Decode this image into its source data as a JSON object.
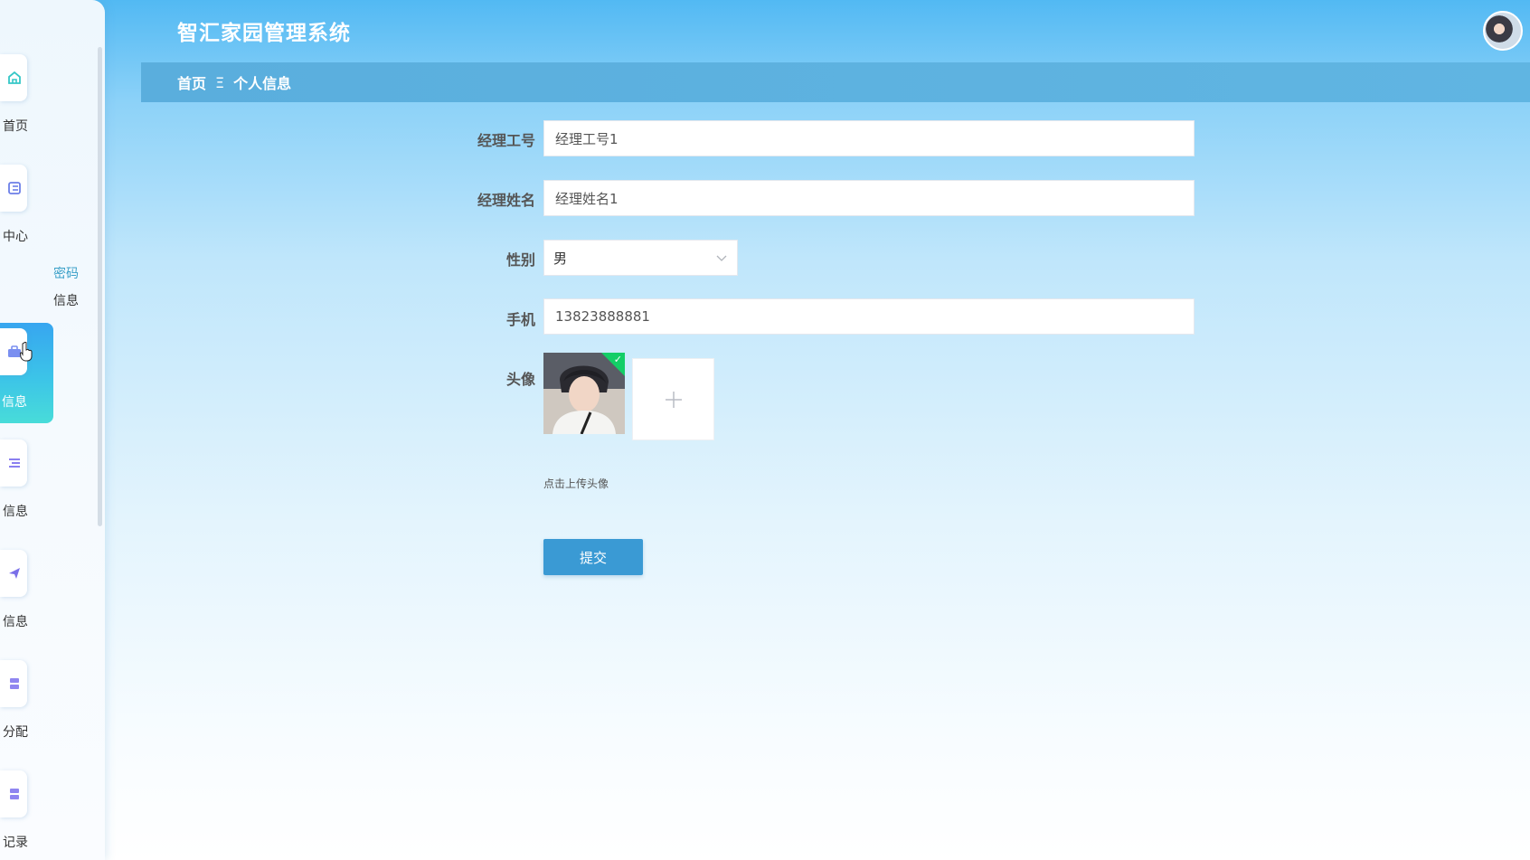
{
  "app": {
    "title": "智汇家园管理系统"
  },
  "breadcrumb": {
    "home": "首页",
    "separator": "Ξ",
    "current": "个人信息"
  },
  "sidebar": {
    "items": [
      {
        "label": "首页",
        "icon": "home-icon"
      },
      {
        "label": "中心",
        "icon": "card-icon"
      },
      {
        "sub_link": "密码",
        "sub_label": "信息"
      },
      {
        "label": "信息",
        "icon": "briefcase-icon",
        "active": true
      },
      {
        "label": "信息",
        "icon": "list-icon"
      },
      {
        "label": "信息",
        "icon": "send-icon"
      },
      {
        "label": "分配",
        "icon": "grid-icon"
      },
      {
        "label": "记录",
        "icon": "grid-icon"
      }
    ]
  },
  "form": {
    "manager_id": {
      "label": "经理工号",
      "value": "经理工号1"
    },
    "manager_name": {
      "label": "经理姓名",
      "value": "经理姓名1"
    },
    "gender": {
      "label": "性别",
      "value": "男"
    },
    "phone": {
      "label": "手机",
      "value": "13823888881"
    },
    "avatar": {
      "label": "头像",
      "hint": "点击上传头像"
    },
    "submit_label": "提交"
  },
  "colors": {
    "header_start": "#52b9f3",
    "breadcrumb_bg": "#5aaedd",
    "active_item": "#3cc4e8",
    "submit_button": "#3a9ad4",
    "upload_success": "#13ce66"
  }
}
